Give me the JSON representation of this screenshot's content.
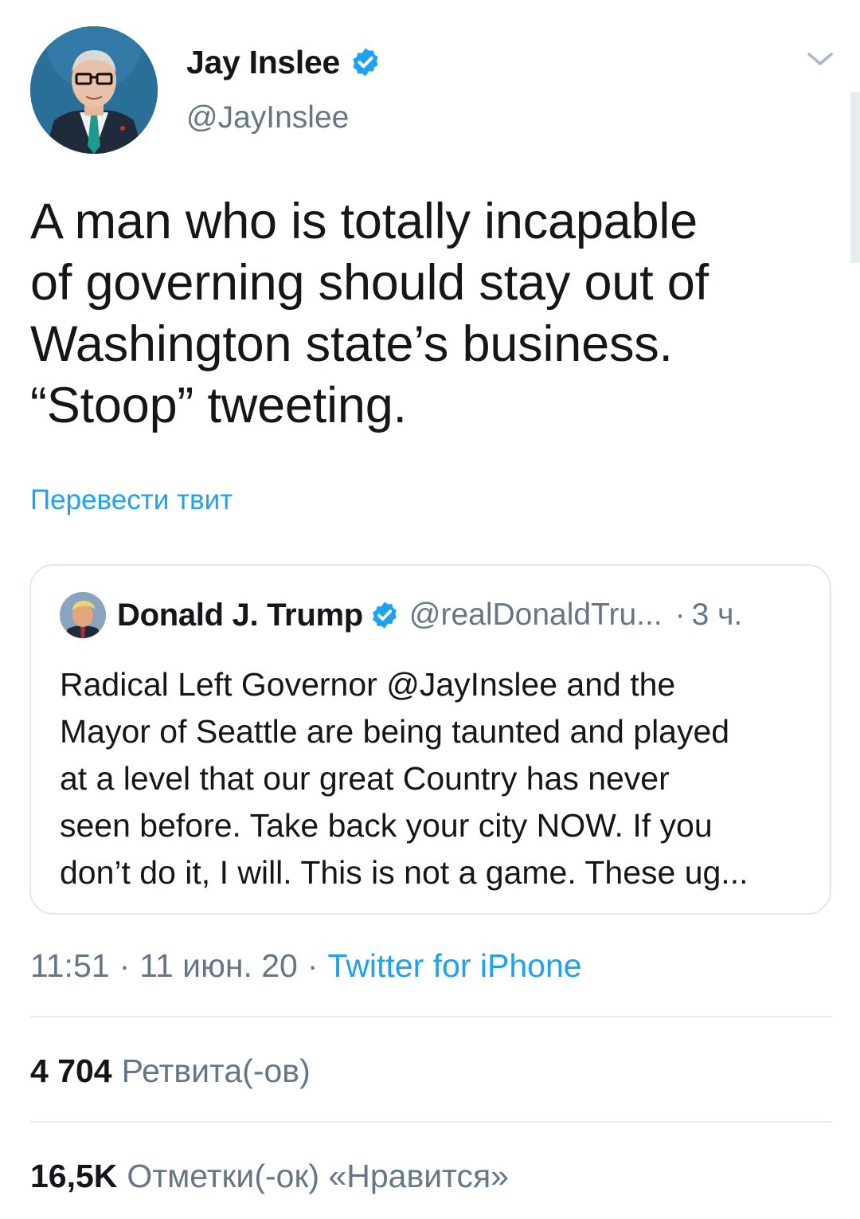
{
  "author": {
    "display_name": "Jay Inslee",
    "handle": "@JayInslee",
    "verified": true
  },
  "tweet": {
    "text": "A man who is totally incapable\nof governing should stay out of\nWashington state’s business.\n“Stoop” tweeting.",
    "translate_label": "Перевести твит"
  },
  "quoted_tweet": {
    "display_name": "Donald J. Trump",
    "handle": "@realDonaldTru...",
    "separator": "·",
    "time_ago": "3 ч.",
    "text": "Radical Left Governor @JayInslee and the\nMayor of Seattle are being taunted and played\nat a level that our great Country has never\nseen before. Take back your city NOW. If you\ndon’t do it, I will. This is not a game. These ug..."
  },
  "meta": {
    "time": "11:51",
    "date": "11 июн. 20",
    "separator": "·",
    "source": "Twitter for iPhone"
  },
  "stats": {
    "retweets_count": "4 704",
    "retweets_label": "Ретвита(-ов)",
    "likes_count": "16,5K",
    "likes_label": "Отметки(-ок) «Нравится»"
  },
  "colors": {
    "accent": "#1da1f2",
    "muted": "#657786",
    "text": "#14171a",
    "border": "#e1e8ed"
  },
  "icons": {
    "verified": "verified-badge-icon",
    "caret": "chevron-down-icon"
  }
}
